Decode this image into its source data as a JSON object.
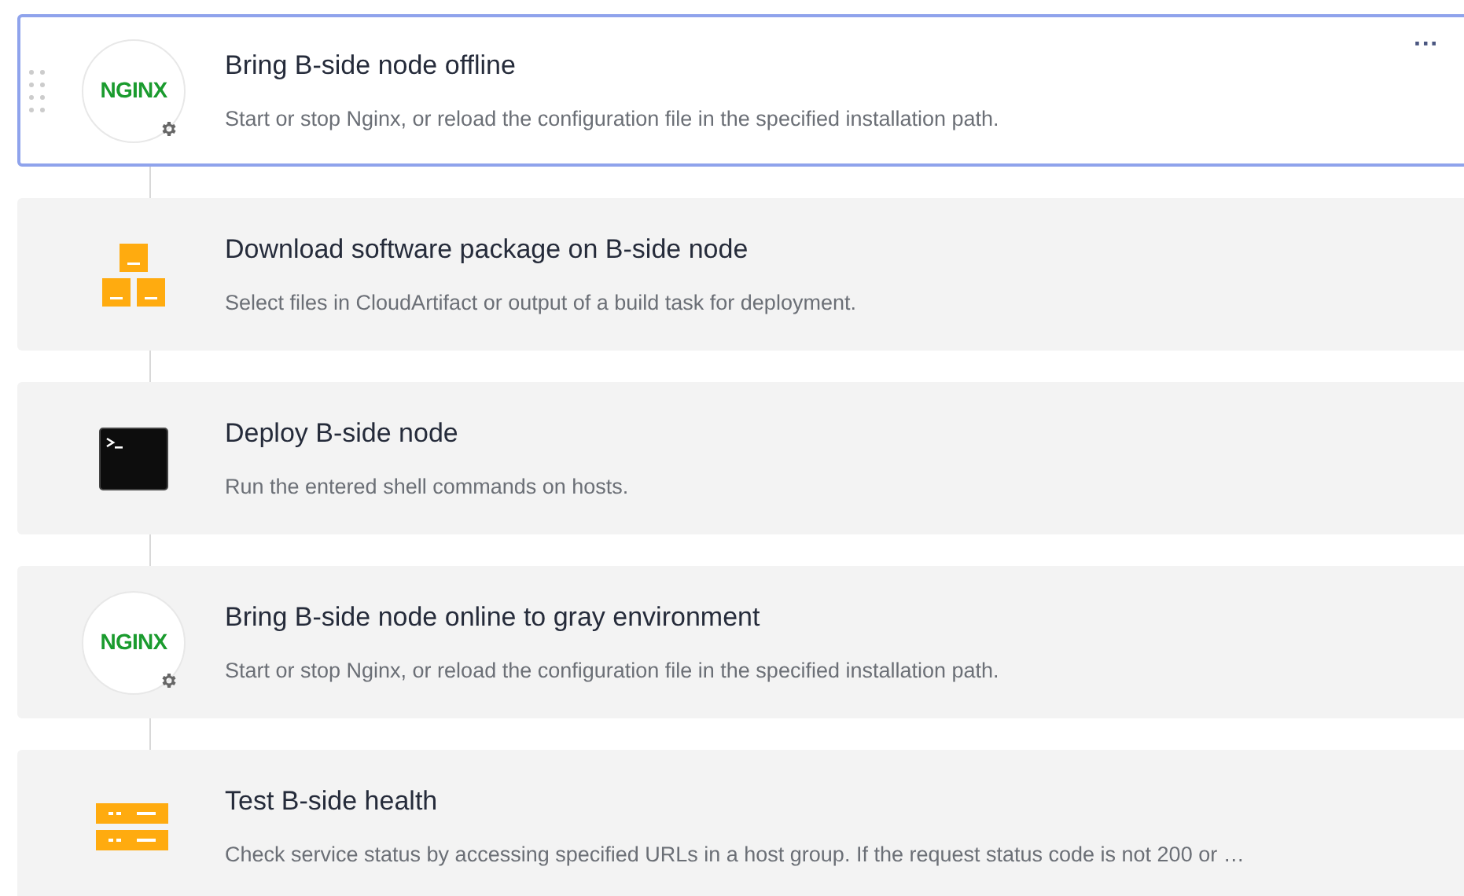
{
  "steps": [
    {
      "kind": "nginx",
      "logo_text": "NGINX",
      "title": "Bring B-side node offline",
      "description": "Start or stop Nginx, or reload the configuration file in the specified installation path.",
      "selected": true,
      "menu": "···"
    },
    {
      "kind": "package",
      "title": "Download software package on B-side node",
      "description": "Select files in CloudArtifact or output of a build task for deployment.",
      "selected": false
    },
    {
      "kind": "shell",
      "title": "Deploy B-side node",
      "description": "Run the entered shell commands on hosts.",
      "selected": false
    },
    {
      "kind": "nginx",
      "logo_text": "NGINX",
      "title": "Bring B-side node online to gray environment",
      "description": "Start or stop Nginx, or reload the configuration file in the specified installation path.",
      "selected": false
    },
    {
      "kind": "health",
      "title": "Test B-side health",
      "description": "Check service status by accessing specified URLs in a host group. If the request status code is not 200 or …",
      "selected": false
    }
  ]
}
